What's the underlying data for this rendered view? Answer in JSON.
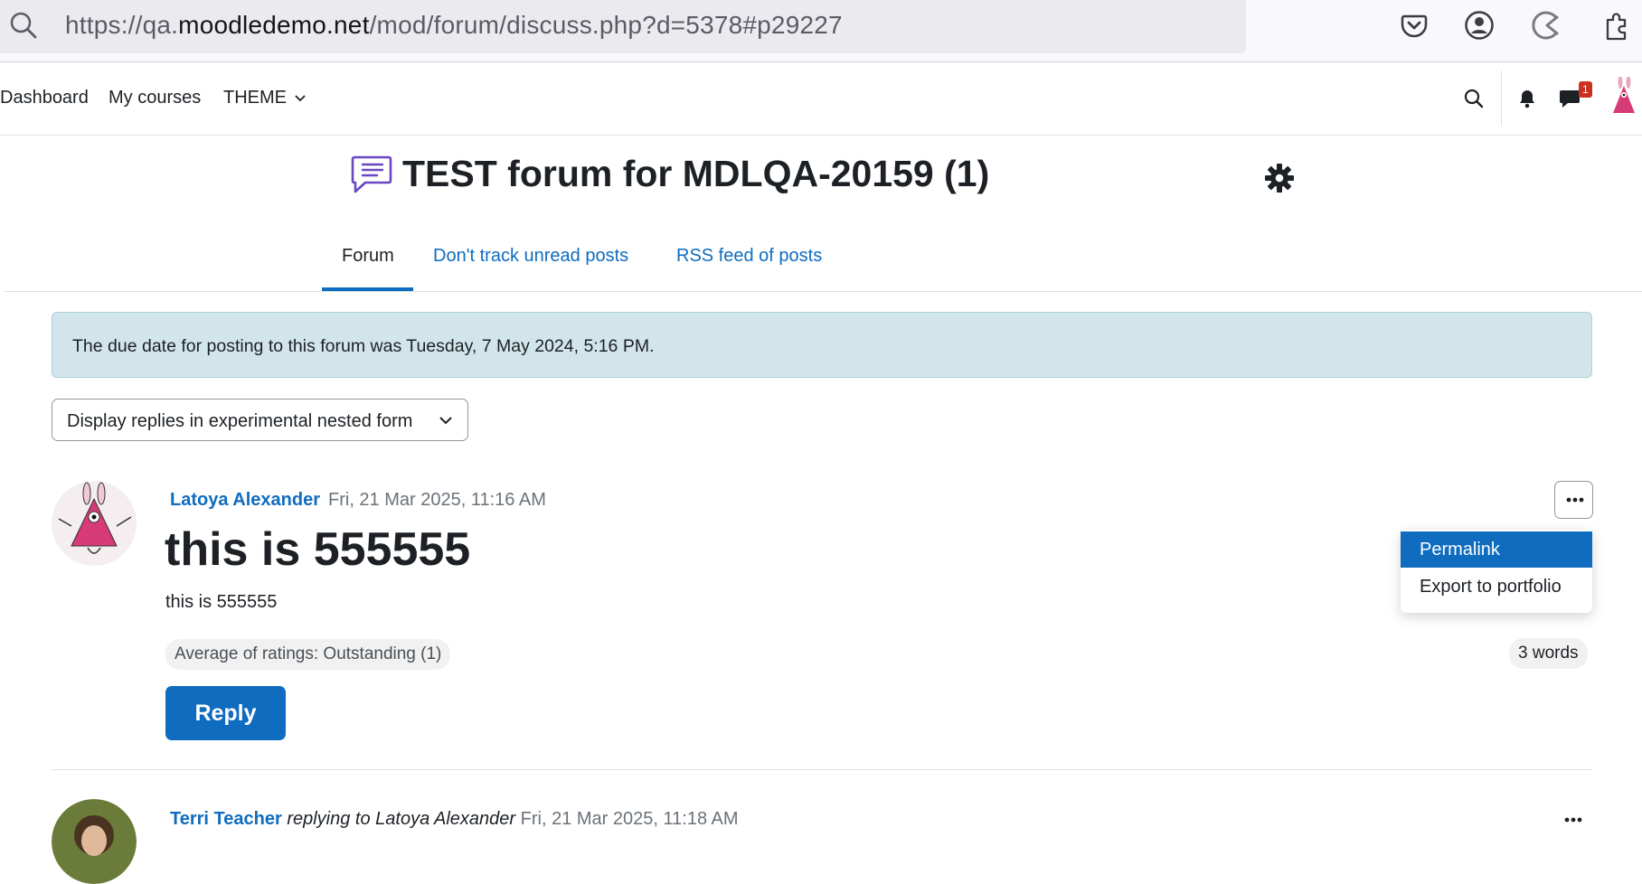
{
  "browser": {
    "url_prefix": "https://qa.",
    "url_domain": "moodledemo.net",
    "url_path": "/mod/forum/discuss.php?d=5378#p29227",
    "icons": [
      "search-icon",
      "pocket-icon",
      "account-icon",
      "loading-icon",
      "extensions-icon"
    ]
  },
  "nav": {
    "items": [
      {
        "label": "Dashboard"
      },
      {
        "label": "My courses"
      },
      {
        "label": "THEME"
      }
    ],
    "messages_badge": "1"
  },
  "page": {
    "title": "TEST forum for MDLQA-20159 (1)",
    "tabs": [
      {
        "label": "Forum",
        "active": true
      },
      {
        "label": "Don't track unread posts",
        "active": false
      },
      {
        "label": "RSS feed of posts",
        "active": false
      }
    ],
    "alert": "The due date for posting to this forum was Tuesday, 7 May 2024, 5:16 PM.",
    "display_mode": "Display replies in experimental nested form"
  },
  "post": {
    "author": "Latoya Alexander",
    "date": "Fri, 21 Mar 2025, 11:16 AM",
    "subject": "this is 555555",
    "body": "this is 555555",
    "ratings": "Average of ratings: Outstanding (1)",
    "word_count": "3 words",
    "reply_label": "Reply",
    "menu": [
      "Permalink",
      "Export to portfolio"
    ]
  },
  "reply_post": {
    "author": "Terri Teacher",
    "replying_to": "replying to Latoya Alexander",
    "date": "Fri, 21 Mar 2025, 11:18 AM"
  },
  "colors": {
    "link": "#0f6cbf",
    "alert_bg": "#d1e5ea",
    "badge": "#ca3120",
    "forum_icon": "#6b46c1"
  }
}
